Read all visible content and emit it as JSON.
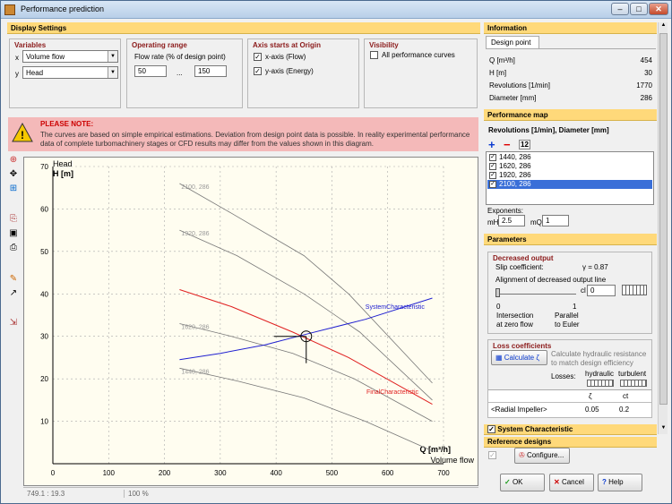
{
  "window": {
    "title": "Performance prediction"
  },
  "display_settings": {
    "header": "Display Settings",
    "variables": {
      "title": "Variables",
      "x_axis": "x",
      "x_value": "Volume flow",
      "y_axis": "y",
      "y_value": "Head"
    },
    "operating_range": {
      "title": "Operating range",
      "label": "Flow rate (% of design point)",
      "from": "50",
      "dots": "...",
      "to": "150"
    },
    "axes_origin": {
      "title": "Axis starts at Origin",
      "x_label": "x-axis (Flow)",
      "x_checked": true,
      "y_label": "y-axis (Energy)",
      "y_checked": true
    },
    "visibility": {
      "title": "Visibility",
      "all_label": "All performance curves",
      "all_checked": false
    }
  },
  "note": {
    "title": "PLEASE NOTE:",
    "line1": "The curves are based on simple empirical estimations. Deviation from design point data is possible. In reality experimental performance",
    "line2": "data of complete turbomachinery stages or CFD results may differ from the values shown in this diagram."
  },
  "toolbar": {
    "icons": [
      "zoom-icon",
      "pan-icon",
      "fit-icon",
      "copy-icon",
      "save-icon",
      "print-icon",
      "edit-icon",
      "pointer-icon",
      "export-icon"
    ]
  },
  "chart_data": {
    "type": "line",
    "y_title": "Head",
    "y_unit": "H [m]",
    "x_title": "Volume flow",
    "x_unit": "Q [m³/h]",
    "xlim": [
      0,
      700
    ],
    "ylim": [
      0,
      70
    ],
    "x_ticks": [
      0,
      100,
      200,
      300,
      400,
      500,
      600,
      700
    ],
    "y_ticks": [
      10,
      20,
      30,
      40,
      50,
      60,
      70
    ],
    "grid": true,
    "series": [
      {
        "name": "2100, 286",
        "color": "#777777",
        "points": [
          [
            227,
            66
          ],
          [
            320,
            59
          ],
          [
            450,
            49
          ],
          [
            530,
            40
          ],
          [
            680,
            19
          ]
        ]
      },
      {
        "name": "1920, 286",
        "color": "#777777",
        "points": [
          [
            227,
            55
          ],
          [
            330,
            49
          ],
          [
            450,
            40
          ],
          [
            550,
            31
          ],
          [
            680,
            15
          ]
        ]
      },
      {
        "name": "FinalCharacteristic",
        "color": "#e02020",
        "points": [
          [
            227,
            41
          ],
          [
            320,
            37
          ],
          [
            430,
            31
          ],
          [
            530,
            25
          ],
          [
            680,
            14
          ]
        ]
      },
      {
        "name": "1620, 286",
        "color": "#777777",
        "points": [
          [
            227,
            33
          ],
          [
            320,
            30
          ],
          [
            430,
            26
          ],
          [
            540,
            20
          ],
          [
            680,
            10
          ]
        ]
      },
      {
        "name": "1440, 286",
        "color": "#777777",
        "points": [
          [
            227,
            22.5
          ],
          [
            330,
            19.5
          ],
          [
            450,
            15.5
          ],
          [
            560,
            10
          ],
          [
            680,
            3
          ]
        ]
      },
      {
        "name": "SystemCharacteristic",
        "color": "#2020d0",
        "points": [
          [
            227,
            24.5
          ],
          [
            300,
            26
          ],
          [
            380,
            28
          ],
          [
            454,
            30.5
          ],
          [
            560,
            34
          ],
          [
            680,
            39
          ]
        ]
      }
    ],
    "design_point": {
      "x": 454,
      "y": 30
    }
  },
  "status": {
    "coords": "749.1 : 19.3",
    "zoom": "100 %"
  },
  "information": {
    "header": "Information",
    "tab": "Design point",
    "rows": [
      {
        "label": "Q [m³/h]",
        "value": "454"
      },
      {
        "label": "H [m]",
        "value": "30"
      },
      {
        "label": "Revolutions [1/min]",
        "value": "1770"
      },
      {
        "label": "Diameter [mm]",
        "value": "286"
      }
    ]
  },
  "perf_map": {
    "header": "Performance map",
    "subtitle": "Revolutions [1/min], Diameter [mm]",
    "sort_label": "12",
    "items": [
      {
        "label": "1440, 286",
        "checked": true
      },
      {
        "label": "1620, 286",
        "checked": true
      },
      {
        "label": "1920, 286",
        "checked": true
      },
      {
        "label": "2100, 286",
        "checked": true
      }
    ],
    "exponents_label": "Exponents:",
    "mh_label": "mH",
    "mh_value": "2.5",
    "mq_label": "mQ",
    "mq_value": "1"
  },
  "parameters": {
    "header": "Parameters",
    "decreased": {
      "title": "Decreased output",
      "slip_label": "Slip coefficient:",
      "slip_value": "γ = 0.87",
      "align_label": "Alignment of decreased output line",
      "cl_label": "cl",
      "cl_value": "0",
      "left_num": "0",
      "right_num": "1",
      "left_text1": "Intersection",
      "left_text2": "at zero flow",
      "right_text1": "Parallel",
      "right_text2": "to Euler"
    },
    "loss": {
      "title": "Loss coefficients",
      "calc_label": "Calculate ζ",
      "calc_note1": "Calculate hydraulic resistance",
      "calc_note2": "to match design efficiency",
      "losses_label": "Losses:",
      "col1": "hydraulic",
      "col2": "turbulent",
      "sym1": "ζ",
      "sym2": "ct",
      "row_label": "<Radial Impeller>",
      "v1": "0.05",
      "v2": "0.2"
    }
  },
  "system_char": {
    "label": "System Characteristic",
    "checked": true
  },
  "reference": {
    "header": "Reference designs",
    "configure": "Configure..."
  },
  "buttons": {
    "ok": "OK",
    "cancel": "Cancel",
    "help": "Help"
  }
}
